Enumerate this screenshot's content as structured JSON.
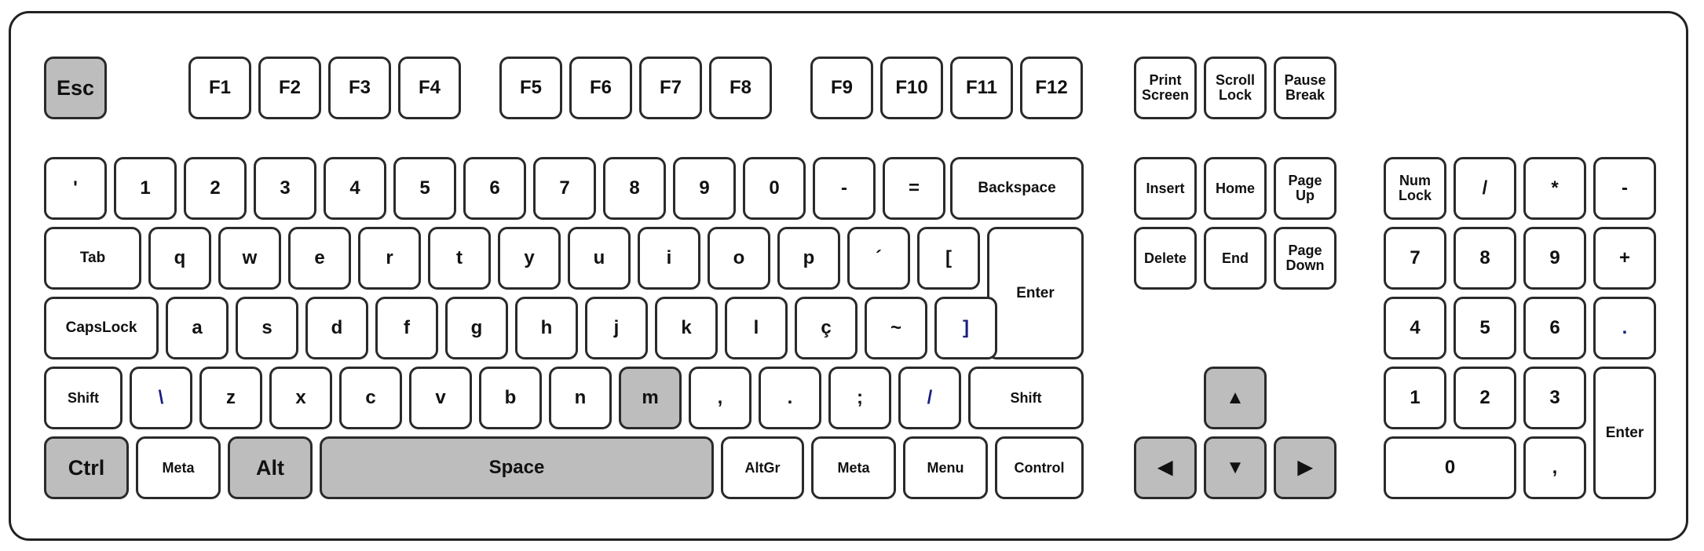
{
  "colors": {
    "key_fill": "#ffffff",
    "key_highlight": "#bdbdbd",
    "key_border": "#2a2a2a",
    "frame_border": "#222222"
  },
  "highlighted_keys": [
    "Esc",
    "m",
    "Ctrl",
    "Alt",
    "Space",
    "arrow-up",
    "arrow-left",
    "arrow-down",
    "arrow-right"
  ],
  "keys": [
    {
      "id": "esc",
      "label": "Esc"
    },
    {
      "id": "f1",
      "label": "F1"
    },
    {
      "id": "f2",
      "label": "F2"
    },
    {
      "id": "f3",
      "label": "F3"
    },
    {
      "id": "f4",
      "label": "F4"
    },
    {
      "id": "f5",
      "label": "F5"
    },
    {
      "id": "f6",
      "label": "F6"
    },
    {
      "id": "f7",
      "label": "F7"
    },
    {
      "id": "f8",
      "label": "F8"
    },
    {
      "id": "f9",
      "label": "F9"
    },
    {
      "id": "f10",
      "label": "F10"
    },
    {
      "id": "f11",
      "label": "F11"
    },
    {
      "id": "f12",
      "label": "F12"
    },
    {
      "id": "printscreen",
      "label": "Print\nScreen"
    },
    {
      "id": "scrolllock",
      "label": "Scroll\nLock"
    },
    {
      "id": "pausebreak",
      "label": "Pause\nBreak"
    },
    {
      "id": "quote",
      "label": "'"
    },
    {
      "id": "d1",
      "label": "1"
    },
    {
      "id": "d2",
      "label": "2"
    },
    {
      "id": "d3",
      "label": "3"
    },
    {
      "id": "d4",
      "label": "4"
    },
    {
      "id": "d5",
      "label": "5"
    },
    {
      "id": "d6",
      "label": "6"
    },
    {
      "id": "d7",
      "label": "7"
    },
    {
      "id": "d8",
      "label": "8"
    },
    {
      "id": "d9",
      "label": "9"
    },
    {
      "id": "d0",
      "label": "0"
    },
    {
      "id": "minus",
      "label": "-"
    },
    {
      "id": "equals",
      "label": "="
    },
    {
      "id": "backspace",
      "label": "Backspace"
    },
    {
      "id": "insert",
      "label": "Insert"
    },
    {
      "id": "home",
      "label": "Home"
    },
    {
      "id": "pageup",
      "label": "Page\nUp"
    },
    {
      "id": "numlock",
      "label": "Num\nLock"
    },
    {
      "id": "np_slash",
      "label": "/"
    },
    {
      "id": "np_star",
      "label": "*"
    },
    {
      "id": "np_minus",
      "label": "-"
    },
    {
      "id": "tab",
      "label": "Tab"
    },
    {
      "id": "q",
      "label": "q"
    },
    {
      "id": "w",
      "label": "w"
    },
    {
      "id": "e",
      "label": "e"
    },
    {
      "id": "r",
      "label": "r"
    },
    {
      "id": "t",
      "label": "t"
    },
    {
      "id": "y",
      "label": "y"
    },
    {
      "id": "u",
      "label": "u"
    },
    {
      "id": "i",
      "label": "i"
    },
    {
      "id": "o",
      "label": "o"
    },
    {
      "id": "p",
      "label": "p"
    },
    {
      "id": "acute",
      "label": "´"
    },
    {
      "id": "lbracket",
      "label": "["
    },
    {
      "id": "enter",
      "label": "Enter"
    },
    {
      "id": "delete",
      "label": "Delete"
    },
    {
      "id": "end",
      "label": "End"
    },
    {
      "id": "pagedown",
      "label": "Page\nDown"
    },
    {
      "id": "np7",
      "label": "7"
    },
    {
      "id": "np8",
      "label": "8"
    },
    {
      "id": "np9",
      "label": "9"
    },
    {
      "id": "np_plus",
      "label": "+"
    },
    {
      "id": "capslock",
      "label": "CapsLock"
    },
    {
      "id": "a",
      "label": "a"
    },
    {
      "id": "s",
      "label": "s"
    },
    {
      "id": "d",
      "label": "d"
    },
    {
      "id": "f",
      "label": "f"
    },
    {
      "id": "g",
      "label": "g"
    },
    {
      "id": "h",
      "label": "h"
    },
    {
      "id": "j",
      "label": "j"
    },
    {
      "id": "k",
      "label": "k"
    },
    {
      "id": "l",
      "label": "l"
    },
    {
      "id": "cedilla",
      "label": "ç"
    },
    {
      "id": "tilde",
      "label": "~"
    },
    {
      "id": "rbracket",
      "label": "]"
    },
    {
      "id": "np4",
      "label": "4"
    },
    {
      "id": "np5",
      "label": "5"
    },
    {
      "id": "np6",
      "label": "6"
    },
    {
      "id": "np_dot",
      "label": "."
    },
    {
      "id": "lshift",
      "label": "Shift"
    },
    {
      "id": "backslash",
      "label": "\\"
    },
    {
      "id": "z",
      "label": "z"
    },
    {
      "id": "x",
      "label": "x"
    },
    {
      "id": "c",
      "label": "c"
    },
    {
      "id": "v",
      "label": "v"
    },
    {
      "id": "b",
      "label": "b"
    },
    {
      "id": "n",
      "label": "n"
    },
    {
      "id": "m",
      "label": "m"
    },
    {
      "id": "comma",
      "label": ","
    },
    {
      "id": "period",
      "label": "."
    },
    {
      "id": "semicolon",
      "label": ";"
    },
    {
      "id": "slash",
      "label": "/"
    },
    {
      "id": "rshift",
      "label": "Shift"
    },
    {
      "id": "arrow_up",
      "label": "▲",
      "icon": "arrow-up-icon"
    },
    {
      "id": "np1",
      "label": "1"
    },
    {
      "id": "np2",
      "label": "2"
    },
    {
      "id": "np3",
      "label": "3"
    },
    {
      "id": "np_enter",
      "label": "Enter"
    },
    {
      "id": "ctrl",
      "label": "Ctrl"
    },
    {
      "id": "lmeta",
      "label": "Meta"
    },
    {
      "id": "alt",
      "label": "Alt"
    },
    {
      "id": "space",
      "label": "Space"
    },
    {
      "id": "altgr",
      "label": "AltGr"
    },
    {
      "id": "rmeta",
      "label": "Meta"
    },
    {
      "id": "menu",
      "label": "Menu"
    },
    {
      "id": "control",
      "label": "Control"
    },
    {
      "id": "arrow_left",
      "label": "◀",
      "icon": "arrow-left-icon"
    },
    {
      "id": "arrow_down",
      "label": "▼",
      "icon": "arrow-down-icon"
    },
    {
      "id": "arrow_right",
      "label": "▶",
      "icon": "arrow-right-icon"
    },
    {
      "id": "np0",
      "label": "0"
    },
    {
      "id": "np_comma",
      "label": ","
    }
  ]
}
